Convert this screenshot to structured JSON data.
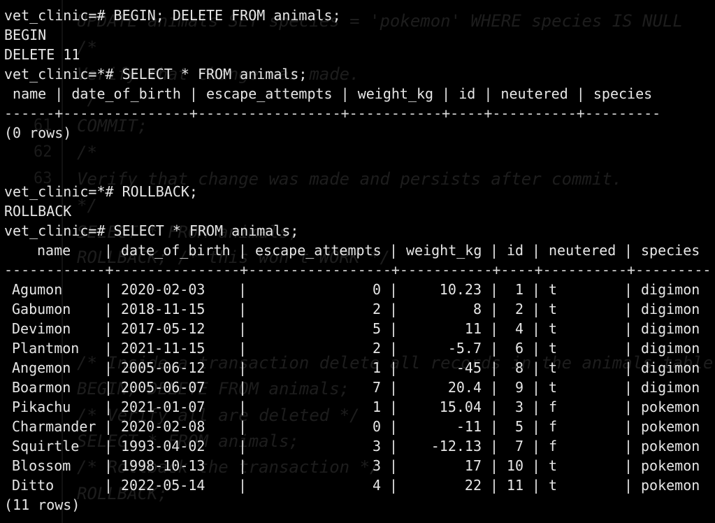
{
  "session": {
    "lines": [
      "vet_clinic=# BEGIN; DELETE FROM animals;",
      "BEGIN",
      "DELETE 11",
      "vet_clinic=*# SELECT * FROM animals;",
      " name | date_of_birth | escape_attempts | weight_kg | id | neutered | species ",
      "------+---------------+-----------------+-----------+----+----------+---------",
      "(0 rows)",
      "",
      "vet_clinic=*# ROLLBACK;",
      "ROLLBACK",
      "vet_clinic=# SELECT * FROM animals;"
    ],
    "table_header": [
      "name",
      "date_of_birth",
      "escape_attempts",
      "weight_kg",
      "id",
      "neutered",
      "species"
    ],
    "table_divider": "------------+---------------+-----------------+-----------+----+----------+---------",
    "rows": [
      [
        "Agumon",
        "2020-02-03",
        "",
        "0",
        "10.23",
        "1",
        "t",
        "digimon"
      ],
      [
        "Gabumon",
        "2018-11-15",
        "",
        "2",
        "8",
        "2",
        "t",
        "digimon"
      ],
      [
        "Devimon",
        "2017-05-12",
        "",
        "5",
        "11",
        "4",
        "t",
        "digimon"
      ],
      [
        "Plantmon",
        "2021-11-15",
        "",
        "2",
        "-5.7",
        "6",
        "t",
        "digimon"
      ],
      [
        "Angemon",
        "2005-06-12",
        "",
        "1",
        "-45",
        "8",
        "t",
        "digimon"
      ],
      [
        "Boarmon",
        "2005-06-07",
        "",
        "7",
        "20.4",
        "9",
        "t",
        "digimon"
      ],
      [
        "Pikachu",
        "2021-01-07",
        "",
        "1",
        "15.04",
        "3",
        "f",
        "pokemon"
      ],
      [
        "Charmander",
        "2020-02-08",
        "",
        "0",
        "-11",
        "5",
        "f",
        "pokemon"
      ],
      [
        "Squirtle",
        "1993-04-02",
        "",
        "3",
        "-12.13",
        "7",
        "f",
        "pokemon"
      ],
      [
        "Blossom",
        "1998-10-13",
        "",
        "3",
        "17",
        "10",
        "t",
        "pokemon"
      ],
      [
        "Ditto",
        "2022-05-14",
        "",
        "4",
        "22",
        "11",
        "t",
        "pokemon"
      ]
    ],
    "footer": "(11 rows)"
  },
  "background_editor": {
    "lines": [
      {
        "num": "",
        "text": "UPDATE animals SET species = 'pokemon' WHERE species IS NULL"
      },
      {
        "num": "",
        "text": "/*"
      },
      {
        "num": "",
        "text": "Verify that change was made."
      },
      {
        "num": "",
        "text": "*/"
      },
      {
        "num": "61",
        "text": "COMMIT;"
      },
      {
        "num": "62",
        "text": "/*"
      },
      {
        "num": "63",
        "text": "Verify that change was made and persists after commit."
      },
      {
        "num": "",
        "text": "*/"
      },
      {
        "num": "",
        "text": "SELECT * FROM animals;"
      },
      {
        "num": "",
        "text": "ROLLBACK; /* this won't WORK */"
      },
      {
        "num": "",
        "text": "/* Inside a transaction delete all records in the animals table"
      },
      {
        "num": "",
        "text": "BEGIN; DELETE FROM animals;"
      },
      {
        "num": "",
        "text": "/* Verify all are deleted */"
      },
      {
        "num": "",
        "text": "SELECT * FROM animals;"
      },
      {
        "num": "",
        "text": "/* Rollback the transaction */"
      },
      {
        "num": "",
        "text": "ROLLBACK;"
      }
    ]
  },
  "colors": {
    "background": "#000000",
    "foreground": "#e6e6e6",
    "ghost_text": "#1d1d1d"
  }
}
